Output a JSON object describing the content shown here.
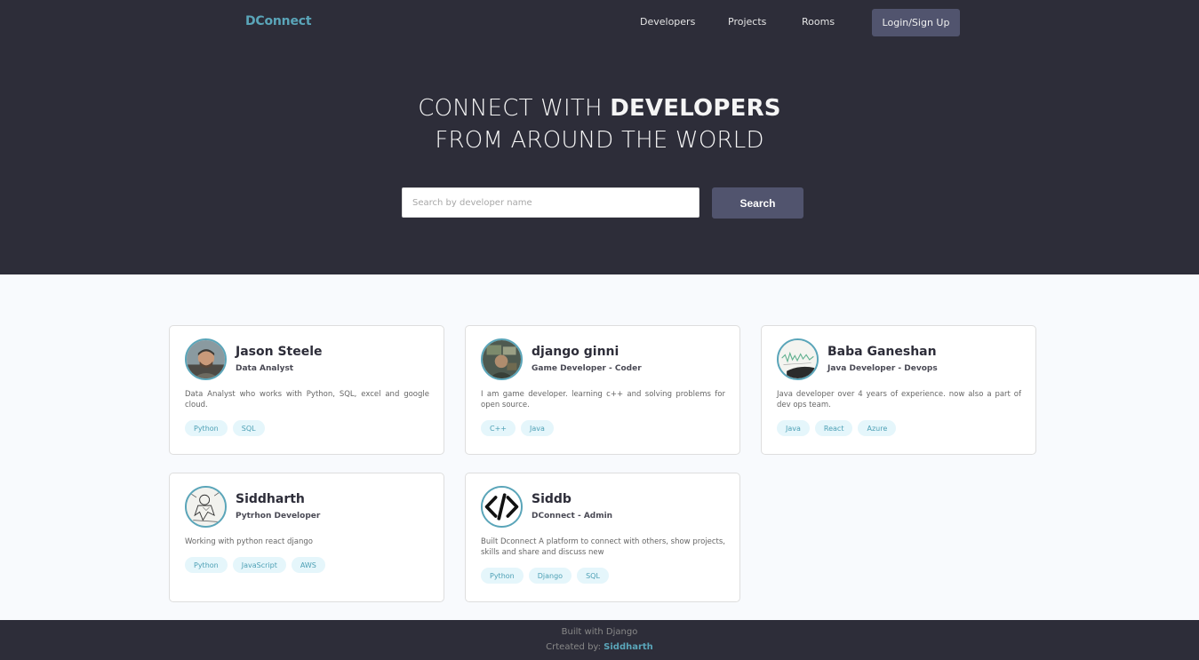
{
  "nav": {
    "logo": "DConnect",
    "links": [
      "Developers",
      "Projects",
      "Rooms"
    ],
    "login": "Login/Sign Up"
  },
  "hero": {
    "line1_prefix": "CONNECT WITH ",
    "line1_bold": "DEVELOPERS",
    "line2": "FROM AROUND THE WORLD"
  },
  "search": {
    "placeholder": "Search by developer name",
    "value": "",
    "button": "Search"
  },
  "developers": [
    {
      "name": "Jason Steele",
      "role": "Data Analyst",
      "bio": "Data Analyst who works with Python, SQL, excel and google cloud.",
      "skills": [
        "Python",
        "SQL"
      ],
      "avatar": "person-photo-icon"
    },
    {
      "name": "django ginni",
      "role": "Game Developer - Coder",
      "bio": "I am game developer. learning c++ and solving problems for open source.",
      "skills": [
        "C++",
        "Java"
      ],
      "avatar": "gaming-photo-icon"
    },
    {
      "name": "Baba Ganeshan",
      "role": "Java Developer - Devops",
      "bio": "Java developer over 4 years of experience. now also a part of dev ops team.",
      "skills": [
        "Java",
        "React",
        "Azure"
      ],
      "avatar": "sketch-photo-icon"
    },
    {
      "name": "Siddharth",
      "role": "Pytrhon Developer",
      "bio": "Working with python react django",
      "skills": [
        "Python",
        "JavaScript",
        "AWS"
      ],
      "avatar": "drawing-photo-icon"
    },
    {
      "name": "Siddb",
      "role": "DConnect - Admin",
      "bio": "Built Dconnect A platform to connect with others, show projects, skills and share and discuss new",
      "skills": [
        "Python",
        "Django",
        "SQL"
      ],
      "avatar": "code-icon"
    }
  ],
  "footer": {
    "line1": "Built with Django",
    "line2_prefix": "Crteated by: ",
    "author": "Siddharth"
  },
  "colors": {
    "dark": "#2d2d39",
    "accent": "#5aa5b9",
    "button": "#51546e",
    "tag_bg": "#e5f6fb"
  }
}
